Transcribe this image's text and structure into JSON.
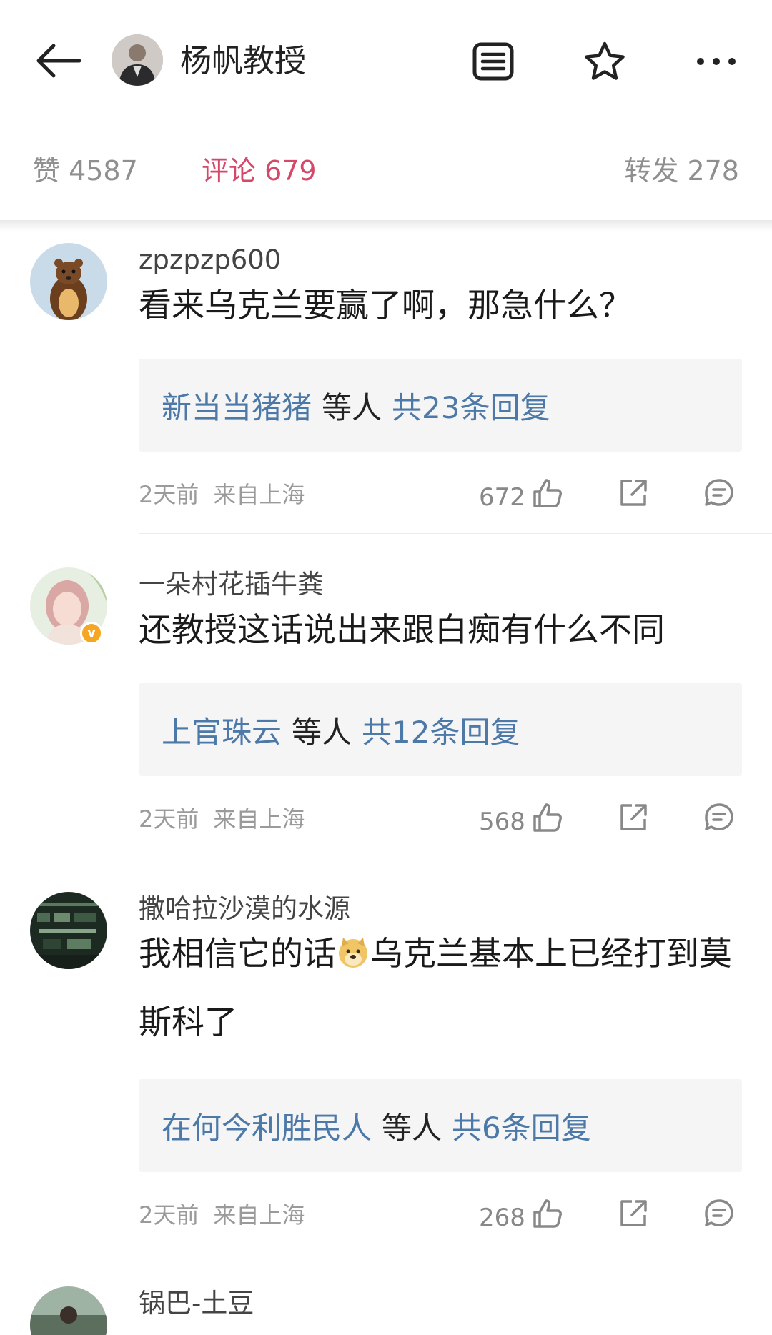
{
  "header": {
    "title": "杨帆教授",
    "icons": {
      "back": "arrow-left-icon",
      "menu": "list-icon",
      "star": "star-icon",
      "more": "more-dots-icon"
    }
  },
  "tabs": {
    "likes": "赞 4587",
    "comments": "评论 679",
    "reposts": "转发 278"
  },
  "colors": {
    "active_tab": "#d6486a",
    "link": "#4d79a8",
    "vip_badge": "#f5a623"
  },
  "comments": [
    {
      "user": "zpzpzp600",
      "text": "看来乌克兰要赢了啊，那急什么？",
      "reply_name": "新当当猪猪",
      "reply_mid": "等人",
      "reply_count": "共23条回复",
      "time": "2天前",
      "location": "来自上海",
      "likes": "672"
    },
    {
      "user": "一朵村花插牛粪",
      "text": "还教授这话说出来跟白痴有什么不同",
      "reply_name": "上官珠云",
      "reply_mid": "等人",
      "reply_count": "共12条回复",
      "time": "2天前",
      "location": "来自上海",
      "likes": "568",
      "badge": "v"
    },
    {
      "user": "撒哈拉沙漠的水源",
      "text_before": "我相信它的话",
      "text_after": "乌克兰基本上已经打到莫斯科了",
      "reply_name": "在何今利胜民人",
      "reply_mid": "等人",
      "reply_count": "共6条回复",
      "time": "2天前",
      "location": "来自上海",
      "likes": "268"
    },
    {
      "user": "锅巴-土豆"
    }
  ]
}
